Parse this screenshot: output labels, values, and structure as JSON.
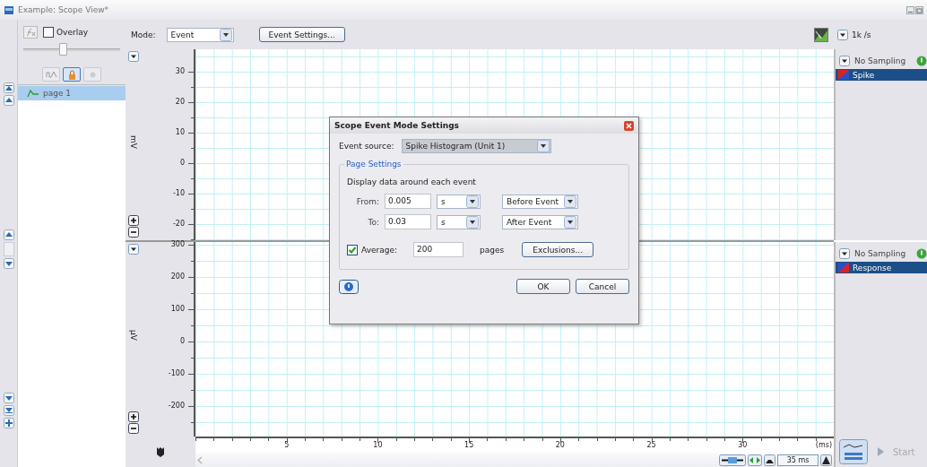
{
  "window": {
    "title": "Example: Scope View*"
  },
  "left_panel": {
    "overlay": {
      "label": "Overlay",
      "checked": false
    },
    "slider": {
      "level": 0.4
    },
    "tools": [
      {
        "kind": "wave",
        "selected": false
      },
      {
        "kind": "lock",
        "selected": true
      },
      {
        "kind": "dot",
        "selected": false
      }
    ],
    "pages": [
      {
        "label": "page 1",
        "selected": true
      }
    ]
  },
  "toolbar": {
    "mode_label": "Mode:",
    "mode_value": "Event",
    "event_settings": "Event Settings...",
    "rate": "1k /s"
  },
  "plots": [
    {
      "unit": "mV",
      "yticks": [
        "30",
        "20",
        "10",
        "0",
        "-10",
        "-20"
      ],
      "channel": {
        "sampling": "No Sampling",
        "name": "Spike",
        "selected": true
      }
    },
    {
      "unit": "µV",
      "yticks": [
        "300",
        "200",
        "100",
        "0",
        "-100",
        "-200"
      ],
      "channel": {
        "sampling": "No Sampling",
        "name": "Response",
        "selected": true
      }
    }
  ],
  "x_axis": {
    "ticks": [
      "5",
      "10",
      "15",
      "20",
      "25",
      "30"
    ],
    "unit": "(ms)"
  },
  "time_controls": {
    "span": "35 ms"
  },
  "start_button": {
    "label": "Start",
    "disabled": true
  },
  "dialog": {
    "title": "Scope Event Mode Settings",
    "source_label": "Event source:",
    "source_value": "Spike Histogram (Unit 1)",
    "group_title": "Page Settings",
    "description": "Display data around each event",
    "ranges": [
      {
        "label": "From:",
        "value": "0.005",
        "unit": "s",
        "relation": "Before Event"
      },
      {
        "label": "To:",
        "value": "0.03",
        "unit": "s",
        "relation": "After Event"
      }
    ],
    "average": {
      "label": "Average:",
      "checked": true,
      "value": "200",
      "suffix": "pages"
    },
    "exclusions": "Exclusions...",
    "ok": "OK",
    "cancel": "Cancel"
  }
}
